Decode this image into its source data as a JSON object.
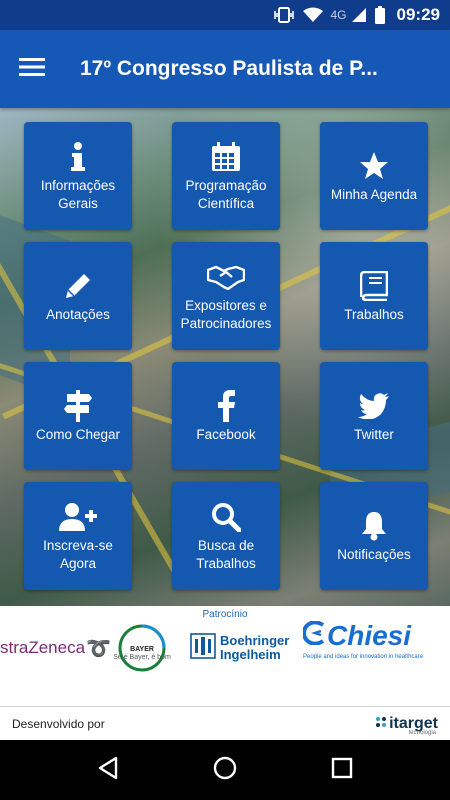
{
  "status_bar": {
    "network": "4G",
    "time": "09:29",
    "icons": [
      "vibrate-icon",
      "wifi-icon",
      "signal-icon",
      "battery-icon"
    ]
  },
  "app_bar": {
    "title": "17º Congresso Paulista de P...",
    "menu_icon": "hamburger-menu-icon"
  },
  "tiles": [
    {
      "label": "Informações Gerais",
      "icon": "info-icon"
    },
    {
      "label": "Programação Científica",
      "icon": "calendar-icon"
    },
    {
      "label": "Minha Agenda",
      "icon": "star-icon"
    },
    {
      "label": "Anotações",
      "icon": "pencil-icon"
    },
    {
      "label": "Expositores e Patrocinadores",
      "icon": "handshake-icon"
    },
    {
      "label": "Trabalhos",
      "icon": "book-icon"
    },
    {
      "label": "Como Chegar",
      "icon": "signpost-icon"
    },
    {
      "label": "Facebook",
      "icon": "facebook-icon"
    },
    {
      "label": "Twitter",
      "icon": "twitter-icon"
    },
    {
      "label": "Inscreva-se Agora",
      "icon": "add-user-icon"
    },
    {
      "label": "Busca de Trabalhos",
      "icon": "search-icon"
    },
    {
      "label": "Notificações",
      "icon": "bell-icon"
    }
  ],
  "sponsors": {
    "title": "Patrocínio",
    "astrazeneca": "straZeneca",
    "bayer": {
      "logo": "BAYER",
      "tagline": "Se é Bayer, é bom"
    },
    "boehringer": [
      "Boehringer",
      "Ingelheim"
    ],
    "chiesi": {
      "name": "Chiesi",
      "tagline": "People and ideas for innovation in healthcare"
    }
  },
  "developer": {
    "label": "Desenvolvido por",
    "company": "itarget",
    "company_sub": "tecnologia"
  },
  "colors": {
    "status_bar": "#0f3d8c",
    "app_bar": "#1558b5",
    "tile": "#1458b0",
    "accent": "#1a6ed0"
  },
  "nav_bar": {
    "buttons": [
      "back-icon",
      "home-icon",
      "recents-icon"
    ]
  }
}
